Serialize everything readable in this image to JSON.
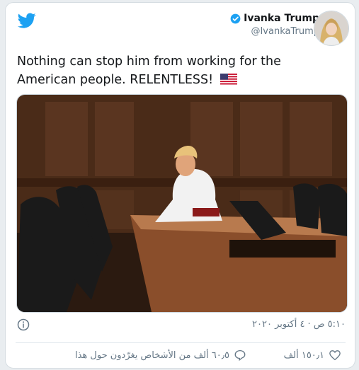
{
  "tweet": {
    "author_name": "Ivanka Trump",
    "handle": "@IvankaTrump",
    "text": "Nothing can stop him from working for the American people. RELENTLESS!",
    "timestamp": "٥:١٠ ص · ٤ أكتوبر ٢٠٢٠",
    "likes_count": "١٥٠٫١ ألف",
    "talking_label": "٦٠٫٥ ألف من الأشخاص يغرّدون حول هذا"
  },
  "icons": {
    "logo": "twitter-bird-icon",
    "verified": "verified-badge-icon",
    "flag": "us-flag-emoji",
    "info": "info-icon",
    "like": "heart-icon",
    "reply": "speech-bubble-icon"
  },
  "colors": {
    "brand": "#1da1f2",
    "text": "#14171a",
    "muted": "#657786"
  }
}
